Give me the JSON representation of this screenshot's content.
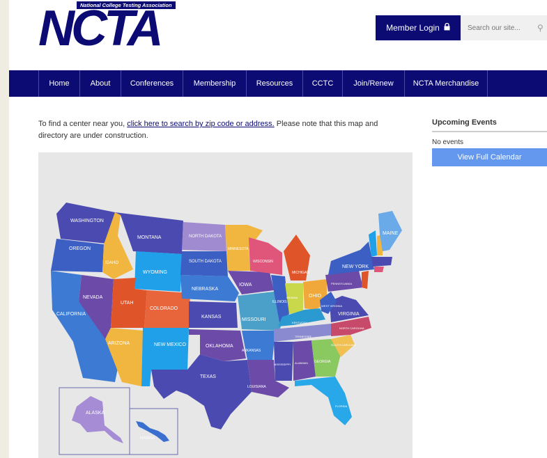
{
  "header": {
    "logo_tagline": "National College Testing Association",
    "logo_text": "NCTA",
    "login_label": "Member Login",
    "search_placeholder": "Search our site..."
  },
  "nav": {
    "items": [
      "Home",
      "About",
      "Conferences",
      "Membership",
      "Resources",
      "CCTC",
      "Join/Renew",
      "NCTA Merchandise"
    ]
  },
  "content": {
    "intro_before": "To find a center near you, ",
    "intro_link": "click here to search by zip code or address.",
    "intro_after": " Please note that this map and directory are under construction."
  },
  "sidebar": {
    "title": "Upcoming Events",
    "no_events": "No events",
    "calendar_button": "View Full Calendar"
  },
  "map": {
    "state_labels": [
      "WASHINGTON",
      "OREGON",
      "CALIFORNIA",
      "NEVADA",
      "IDAHO",
      "MONTANA",
      "WYOMING",
      "UTAH",
      "ARIZONA",
      "COLORADO",
      "NEW MEXICO",
      "NORTH DAKOTA",
      "SOUTH DAKOTA",
      "NEBRASKA",
      "KANSAS",
      "OKLAHOMA",
      "TEXAS",
      "MINNESOTA",
      "IOWA",
      "MISSOURI",
      "ARKANSAS",
      "LOUISIANA",
      "WISCONSIN",
      "ILLINOIS",
      "MICHIGAN",
      "INDIANA",
      "OHIO",
      "KENTUCKY",
      "TENNESSEE",
      "MISSISSIPPI",
      "ALABAMA",
      "GEORGIA",
      "FLORIDA",
      "SOUTH CAROLINA",
      "NORTH CAROLINA",
      "VIRGINIA",
      "WEST VIRGINIA",
      "PENNSYLVANIA",
      "NEW YORK",
      "MAINE",
      "ALASKA",
      "HAWAII"
    ]
  }
}
